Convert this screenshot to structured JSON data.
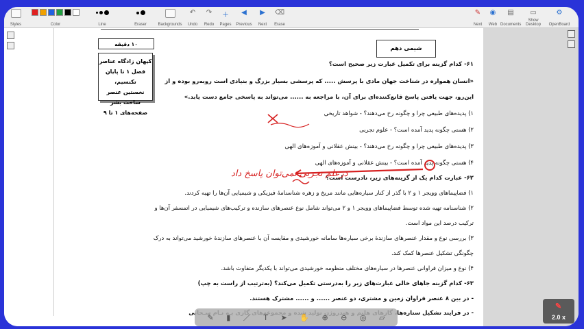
{
  "toolbar": {
    "groups": [
      {
        "id": "styles",
        "label": "Styles"
      },
      {
        "id": "color",
        "label": "Color"
      },
      {
        "id": "line",
        "label": "Line"
      },
      {
        "id": "eraser",
        "label": "Eraser"
      },
      {
        "id": "backgrounds",
        "label": "Backgrounds"
      },
      {
        "id": "undo",
        "label": "Undo"
      },
      {
        "id": "redo",
        "label": "Redo"
      },
      {
        "id": "pages",
        "label": "Pages"
      },
      {
        "id": "previous",
        "label": "Previous"
      },
      {
        "id": "next",
        "label": "Next"
      },
      {
        "id": "erase",
        "label": "Erase"
      },
      {
        "id": "next_r",
        "label": "Next"
      },
      {
        "id": "web",
        "label": "Web"
      },
      {
        "id": "documents",
        "label": "Documents"
      },
      {
        "id": "show_desktop",
        "label": "Show Desktop"
      },
      {
        "id": "openboard",
        "label": "OpenBoard"
      }
    ],
    "palette": [
      "#e02020",
      "#f0a000",
      "#2060e0",
      "#20a040",
      "#000000",
      "#ffffff"
    ]
  },
  "document": {
    "subject": "شیمی دهم",
    "time": "۱۰ دقیقه",
    "topics": [
      "کیهان زادگاه عناصر",
      "فصل ۱ تا پایان تکنسیم،",
      "نخستین عنصر ساخت بشر",
      "صفحه‌های ۱ تا ۹"
    ],
    "q61_title": "۶۱- کدام گزینه برای تکمیل عبارت زیر صحیح است؟",
    "q61_stem1": "«انسان همواره در شناخت جهان مادی با پرسش ..... که پرسشی بسیار بزرگ و بنیادی است روبه‌رو بوده و از",
    "q61_stem2": "این‌رو، جهت یافتن پاسخ قانع‌کننده‌ای برای آن، با مراجعه به ...... می‌تواند به پاسخی جامع دست یابد.»",
    "q61_opts": [
      "۱) پدیده‌های طبیعی چرا و چگونه رخ می‌دهند؟ - شواهد تاریخی",
      "۲) هستی چگونه پدید آمده است؟ - علوم تجربی",
      "۳) پدیده‌های طبیعی چرا و چگونه رخ می‌دهند؟ - بینش عقلانی و آموزه‌های الهی",
      "۴) هستی چگونه پدید آمده است؟ - بینش عقلانی و آموزه‌های الهی"
    ],
    "q62_title": "۶۲- عبارت کدام یک از گزینه‌های زیر، نادرست است؟",
    "q62_opts": [
      "۱) فضاپیماهای وویجر ۱ و ۲ با گذر از کنار سیاره‌هایی مانند مریخ و زهره شناسنامهٔ فیزیکی و شیمیایی آن‌ها را تهیه کردند.",
      "۲) شناسنامه تهیه شده توسط فضاپیماهای وویجر ۱ و ۲ می‌تواند شامل نوع عنصرهای سازنده و ترکیب‌های شیمیایی در اتمسفر آن‌ها و",
      "ترکیب درصد این مواد است.",
      "۳) بررسی نوع و مقدار عنصرهای سازندهٔ برخی سیاره‌ها سامانه خورشیدی و مقایسه آن با عنصرهای سازندهٔ خورشید می‌تواند به درک",
      "چگونگی تشکیل عنصرها کمک کند.",
      "۴) نوع و میزان فراوانی عنصرها در سیاره‌های مختلف منظومه خورشیدی می‌تواند با یکدیگر متفاوت باشد."
    ],
    "q63_title": "۶۳- کدام گزینه جاهای خالی عبارت‌های زیر را به‌درستی تکمیل می‌کند؟ (به‌ترتیب از راست به چپ)",
    "q63_a": "- در بین ۸ عنصر فراوان زمین و مشتری، دو عنصر ...... و ...... مشترک هستند.",
    "q63_b": "- در فرایند تشکیل ستاره‌ها، گازهای هلیم و هیدروژن تولید شده و مجموعه‌های گازی بـه نـام سـحابی",
    "annotation": "درعلم تجربی نمی‌توان پاسخ داد"
  },
  "playback": {
    "speed": "2.0 x"
  }
}
